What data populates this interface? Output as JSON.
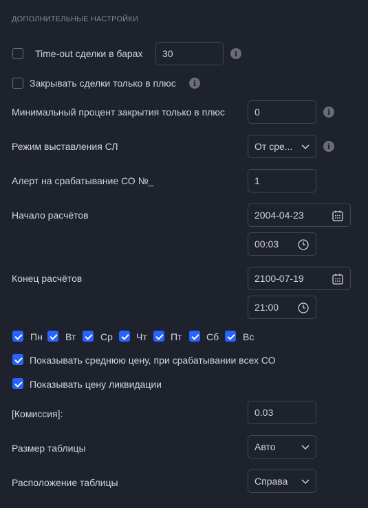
{
  "section_title": "ДОПОЛНИТЕЛЬНЫЕ НАСТРОЙКИ",
  "timeout": {
    "label": "Time-out сделки в барах",
    "value": "30",
    "checked": false
  },
  "close_plus": {
    "label": "Закрывать сделки только в плюс",
    "checked": false
  },
  "min_percent": {
    "label": "Минимальный процент закрытия только в плюс",
    "value": "0"
  },
  "sl_mode": {
    "label": "Режим выставления СЛ",
    "value": "От сре..."
  },
  "alert_co": {
    "label": "Алерт на срабатывание СО №_",
    "value": "1"
  },
  "start": {
    "label": "Начало расчётов",
    "date": "2004-04-23",
    "time": "00:03"
  },
  "end": {
    "label": "Конец расчётов",
    "date": "2100-07-19",
    "time": "21:00"
  },
  "days": [
    {
      "label": "Пн",
      "checked": true
    },
    {
      "label": "Вт",
      "checked": true
    },
    {
      "label": "Ср",
      "checked": true
    },
    {
      "label": "Чт",
      "checked": true
    },
    {
      "label": "Пт",
      "checked": true
    },
    {
      "label": "Сб",
      "checked": true
    },
    {
      "label": "Вс",
      "checked": true
    }
  ],
  "show_avg": {
    "label": "Показывать среднюю цену, при срабатывании всех СО",
    "checked": true
  },
  "show_liq": {
    "label": "Показывать цену ликвидации",
    "checked": true
  },
  "commission": {
    "label": "[Комиссия]:",
    "value": "0.03"
  },
  "table_size": {
    "label": "Размер таблицы",
    "value": "Авто"
  },
  "table_pos": {
    "label": "Расположение таблицы",
    "value": "Справа"
  },
  "colors": {
    "background": "#1e222d",
    "accent": "#2962ff",
    "border": "#434651",
    "text": "#d1d4dc",
    "muted": "#868993"
  },
  "icons": {
    "info": "info-icon",
    "calendar": "calendar-icon",
    "clock": "clock-icon",
    "chevron": "chevron-down-icon"
  }
}
